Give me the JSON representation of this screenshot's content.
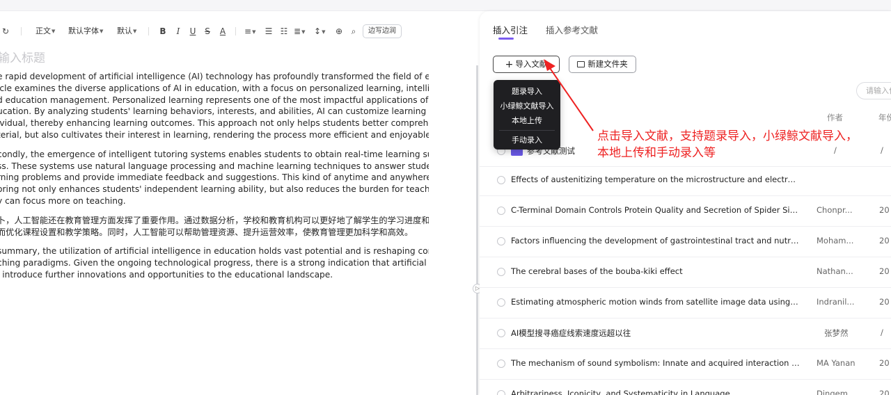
{
  "toolbar": {
    "undo_icon": "undo-icon",
    "redo_icon": "redo-icon",
    "paragraph_style": "正文",
    "font_family": "默认字体",
    "font_size": "默认",
    "bold": "B",
    "italic": "I",
    "underline": "U",
    "strikethrough": "S",
    "font_color": "A",
    "write_while_edit": "边写边润"
  },
  "document": {
    "title_placeholder": "输入标题",
    "paragraphs": [
      [
        "e rapid development of artificial intelligence (AI) technology has profoundly transformed the field of education. This",
        "icle examines the diverse applications of AI in education, with a focus on personalized learning, intelligent tutoring,",
        "d education management. Personalized learning represents one of the most impactful applications of AI in",
        "ucation. By analyzing students' learning behaviors, interests, and abilities, AI can customize learning plans for each",
        "ividual, thereby enhancing learning outcomes. This approach not only helps students better comprehend the",
        "terial, but also cultivates their interest in learning, rendering the process more efficient and enjoyable."
      ],
      [
        "condly, the emergence of intelligent tutoring systems enables students to obtain real-time learning support after",
        "ss. These systems use natural language processing and machine learning techniques to answer students' difficult",
        "rning problems and provide immediate feedback and suggestions. This kind of anytime and anywhere learning",
        "oring not only enhances students' independent learning ability, but also reduces the burden for teachers, so that",
        "y can focus more on teaching."
      ],
      [
        "卜，人工智能还在教育管理方面发挥了重要作用。通过数据分析，学校和教育机构可以更好地了解学生的学习进度和行为模式，",
        "而优化课程设置和教学策略。同时，人工智能可以帮助管理资源、提升运营效率，使教育管理更加科学和高效。"
      ],
      [
        "summary, the utilization of artificial intelligence in education holds vast potential and is reshaping conventional",
        "ching paradigms. Given the ongoing technological progress, there is a strong indication that artificial intelligence",
        "l introduce further innovations and opportunities to the educational landscape."
      ]
    ]
  },
  "panel": {
    "tabs": [
      {
        "label": "插入引注",
        "active": true
      },
      {
        "label": "插入参考文献",
        "active": false
      }
    ],
    "import_button": "导入文献",
    "new_folder_button": "新建文件夹",
    "search_placeholder": "请输入位",
    "columns": {
      "author": "作者",
      "year": "年份"
    },
    "rows": [
      {
        "type": "folder",
        "title": "参考文献测试",
        "author": "/",
        "year": "/"
      },
      {
        "type": "item",
        "title": "Effects of austenitizing temperature on the microstructure and electrochemical behavior",
        "author": "",
        "year": ""
      },
      {
        "type": "item",
        "title": "C-Terminal Domain Controls Protein Quality and Secretion of Spider Silk in Tobacco",
        "author": "Chonpr...",
        "year": "20"
      },
      {
        "type": "item",
        "title": "Factors influencing the development of gastrointestinal tract and nutrient transporters",
        "author": "Moham...",
        "year": "20"
      },
      {
        "type": "item",
        "title": "The cerebral bases of the bouba-kiki effect",
        "author": "Nathan...",
        "year": "20"
      },
      {
        "type": "item",
        "title": "Estimating atmospheric motion winds from satellite image data using space-time",
        "author": "Indranil...",
        "year": "20"
      },
      {
        "type": "item",
        "title": "AI模型搜寻癌症线索速度远超以往",
        "author": "张梦然",
        "year": "/"
      },
      {
        "type": "item",
        "title": "The mechanism of sound symbolism: Innate and acquired interaction modes",
        "author": "MA Yanan",
        "year": "20"
      },
      {
        "type": "item",
        "title": "Arbitrariness, Iconicity, and Systematicity in Language",
        "author": "Dingem...",
        "year": "20"
      }
    ]
  },
  "import_menu": {
    "items": [
      "题录导入",
      "小绿鲸文献导入",
      "本地上传",
      "手动录入"
    ]
  },
  "annotation": {
    "line1": "点击导入文献，支持题录导入，小绿鲸文献导入，",
    "line2": "本地上传和手动录入等",
    "color": "#ee2222"
  },
  "colors": {
    "accent": "#7b5cf0",
    "folder": "#6a5ae8",
    "menu_bg": "#1f1f22"
  }
}
